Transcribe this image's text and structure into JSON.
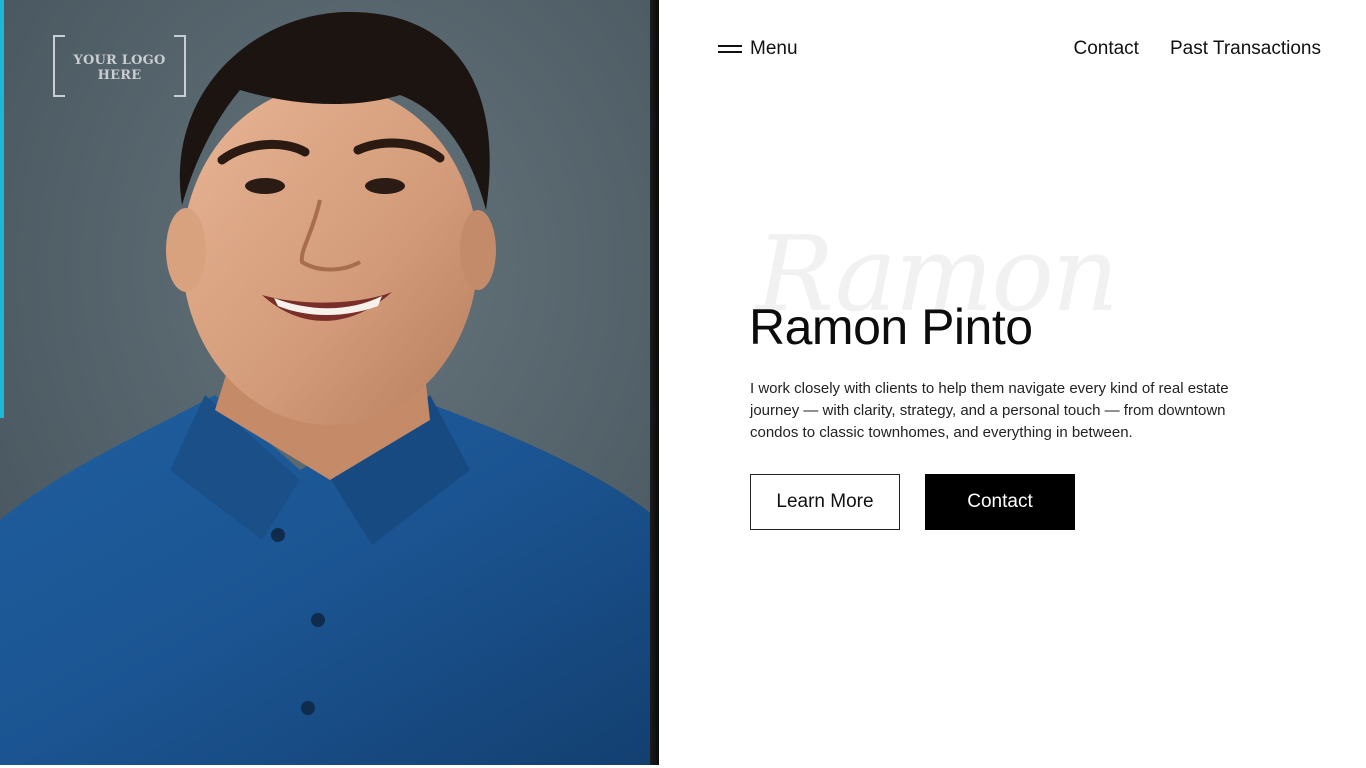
{
  "logo": {
    "text": "YOUR LOGO HERE"
  },
  "header": {
    "menu_label": "Menu",
    "links": [
      "Contact",
      "Past Transactions"
    ]
  },
  "hero": {
    "script_text": "Ramon",
    "name": "Ramon Pinto",
    "description": "I work closely with clients to help them navigate every kind of real estate journey — with clarity, strategy, and a personal touch — from downtown condos to classic townhomes, and everything in between.",
    "buttons": {
      "learn_more": "Learn More",
      "contact": "Contact"
    },
    "photo_alt": "portrait of a smiling young man in a blue polo shirt"
  },
  "colors": {
    "accent_edge": "#1fb7d6",
    "button_primary": "#000000",
    "background": "#ffffff"
  }
}
